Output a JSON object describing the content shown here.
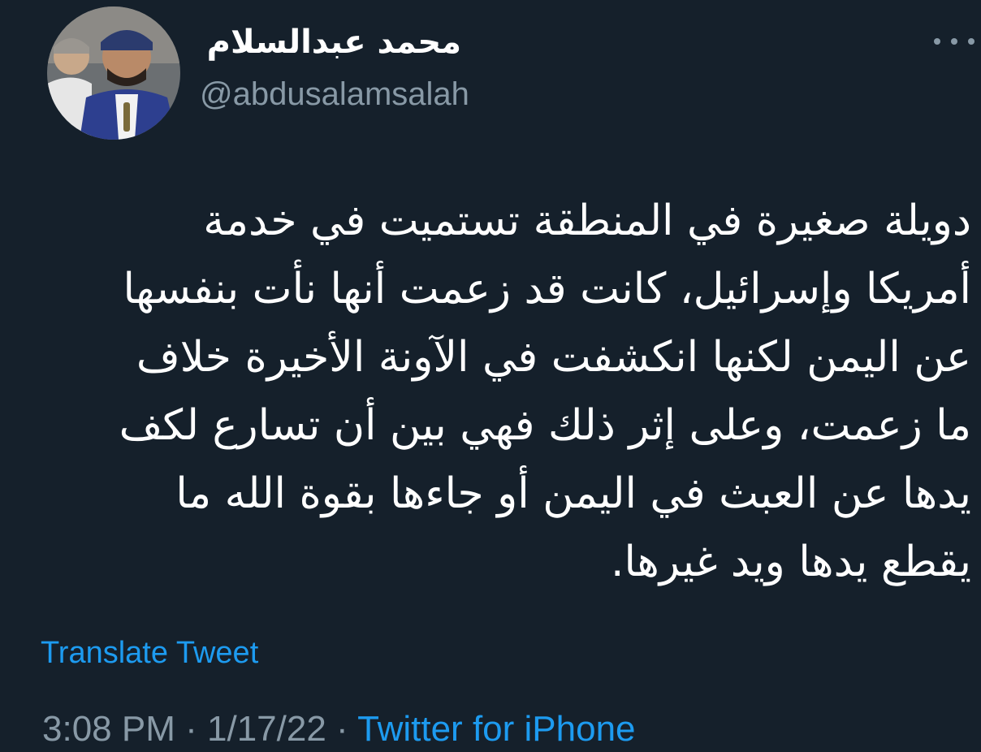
{
  "tweet": {
    "display_name": "محمد عبدالسلام",
    "handle": "@abdusalamsalah",
    "more_icon": "more-horizontal-icon",
    "body_lines": [
      "دويلة صغيرة في المنطقة تستميت في خدمة",
      "أمريكا وإسرائيل، كانت قد زعمت أنها نأت بنفسها",
      "عن اليمن لكنها انكشفت في الآونة الأخيرة خلاف",
      "ما زعمت، وعلى إثر ذلك فهي بين أن تسارع لكف",
      "يدها عن العبث في اليمن أو جاءها بقوة الله ما",
      "يقطع يدها ويد غيرها."
    ],
    "translate_label": "Translate Tweet",
    "time": "3:08 PM",
    "separator": "·",
    "date": "1/17/22",
    "source": "Twitter for iPhone"
  },
  "colors": {
    "background": "#15202b",
    "text": "#ffffff",
    "secondary": "#8899a6",
    "link": "#1d9bf0"
  }
}
